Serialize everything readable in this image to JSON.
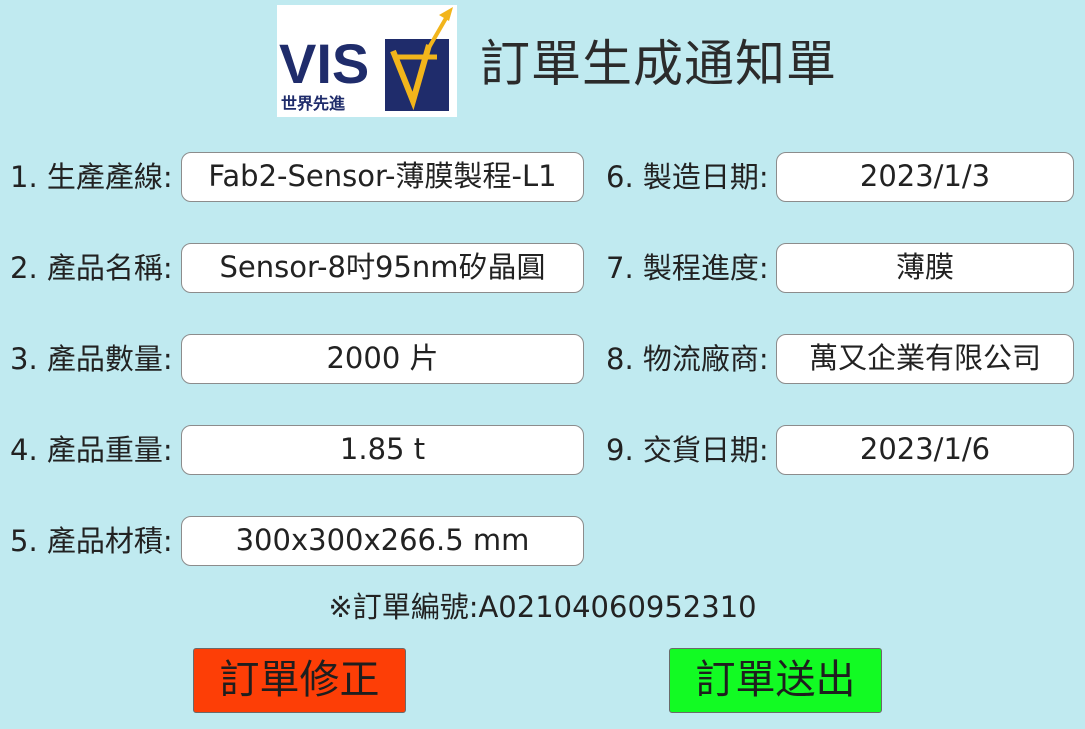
{
  "logo": {
    "text": "VIS",
    "subtitle": "世界先進",
    "colors": {
      "navy": "#1f2c6b",
      "gold": "#f2b51b"
    }
  },
  "title": "訂單生成通知單",
  "fields_left": [
    {
      "label": "1. 生產產線:",
      "value": "Fab2-Sensor-薄膜製程-L1"
    },
    {
      "label": "2. 產品名稱:",
      "value": "Sensor-8吋95nm矽晶圓"
    },
    {
      "label": "3. 產品數量:",
      "value": "2000 片"
    },
    {
      "label": "4. 產品重量:",
      "value": "1.85 t"
    },
    {
      "label": "5. 產品材積:",
      "value": "300x300x266.5 mm"
    }
  ],
  "fields_right": [
    {
      "label": "6. 製造日期:",
      "value": "2023/1/3"
    },
    {
      "label": "7. 製程進度:",
      "value": "薄膜"
    },
    {
      "label": "8. 物流廠商:",
      "value": "萬又企業有限公司"
    },
    {
      "label": "9. 交貨日期:",
      "value": "2023/1/6"
    }
  ],
  "order_number": "※訂單編號:A02104060952310",
  "buttons": {
    "modify": {
      "label": "訂單修正",
      "color": "#fd3e06"
    },
    "send": {
      "label": "訂單送出",
      "color": "#12fb23"
    }
  },
  "background": "#c0eaf0"
}
